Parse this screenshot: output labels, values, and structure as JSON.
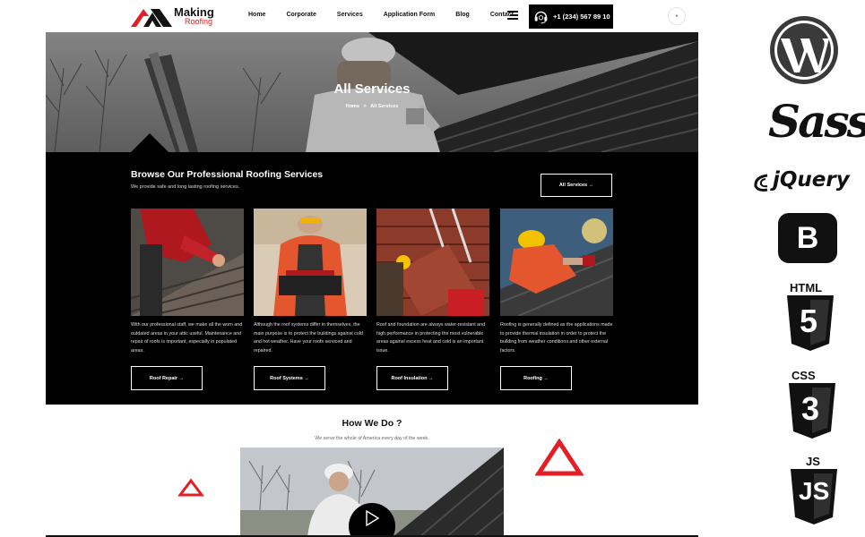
{
  "header": {
    "logo_title": "Making",
    "logo_subtitle": "Roofing",
    "nav": [
      "Home",
      "Corporate",
      "Services",
      "Application Form",
      "Blog",
      "Contact"
    ],
    "phone": "+1 (234) 567 89 10"
  },
  "hero": {
    "title": "All Services",
    "breadcrumb_home": "Home",
    "breadcrumb_sep": ">",
    "breadcrumb_current": "All Services"
  },
  "services": {
    "title": "Browse Our Professional Roofing Services",
    "subtitle": "We provide safe and long lasting roofing services.",
    "all_button": "All Services →",
    "cards": [
      {
        "text": "With our professional staff, we make all the worn and outdated areas in your attic useful. Maintenance and repair of roofs is important, especially in populated areas.",
        "button": "Roof Repair →"
      },
      {
        "text": "Although the roof systems differ in themselves, the main purpose is to protect the buildings against cold and hot weather. Have your roofs serviced and repaired.",
        "button": "Roof Systems →"
      },
      {
        "text": "Roof and foundation are always water-resistant and high performance in protecting the most vulnerable areas against excess heat and cold is an important issue.",
        "button": "Roof Insulation →"
      },
      {
        "text": "Roofing is generally defined as the applications made to provide thermal insulation in order to protect the building from weather conditions and other external factors.",
        "button": "Roofing →"
      }
    ]
  },
  "how": {
    "title": "How We Do ?",
    "subtitle": "We serve the whole of America every day of the week."
  },
  "tech": {
    "sass": "Sass",
    "jquery": "jQuery",
    "bootstrap": "B",
    "html": "HTML",
    "html_num": "5",
    "css": "CSS",
    "css_num": "3",
    "js": "JS"
  },
  "colors": {
    "accent": "#e31e24",
    "dark": "#000000"
  }
}
